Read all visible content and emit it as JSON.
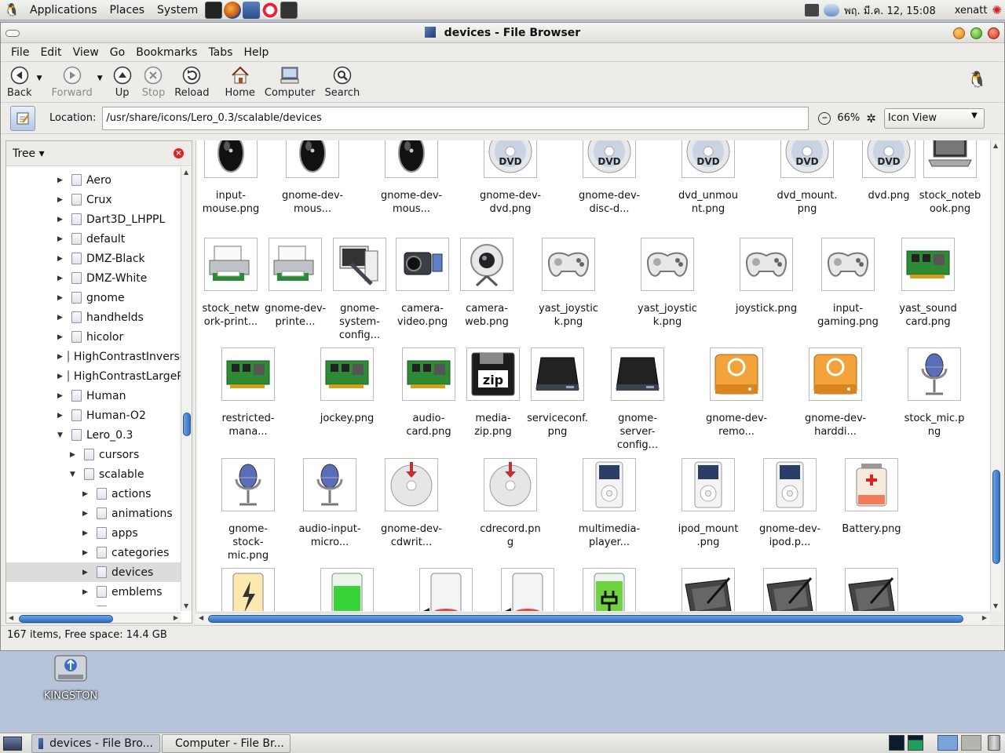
{
  "panel": {
    "menus": [
      "Applications",
      "Places",
      "System"
    ],
    "clock": "พฤ. มี.ค. 12, 15:08",
    "user": "xenatt"
  },
  "window": {
    "title": "devices - File Browser",
    "menus": [
      "File",
      "Edit",
      "View",
      "Go",
      "Bookmarks",
      "Tabs",
      "Help"
    ],
    "toolbar": {
      "back": "Back",
      "forward": "Forward",
      "up": "Up",
      "stop": "Stop",
      "reload": "Reload",
      "home": "Home",
      "computer": "Computer",
      "search": "Search"
    },
    "location_label": "Location:",
    "location": "/usr/share/icons/Lero_0.3/scalable/devices",
    "zoom": "66%",
    "view_mode": "Icon View",
    "sidebar_mode": "Tree",
    "status": "167 items, Free space: 14.4 GB"
  },
  "tree": [
    {
      "label": "Aero",
      "depth": 0,
      "expanded": false
    },
    {
      "label": "Crux",
      "depth": 0,
      "expanded": false
    },
    {
      "label": "Dart3D_LHPPL",
      "depth": 0,
      "expanded": false
    },
    {
      "label": "default",
      "depth": 0,
      "expanded": false
    },
    {
      "label": "DMZ-Black",
      "depth": 0,
      "expanded": false
    },
    {
      "label": "DMZ-White",
      "depth": 0,
      "expanded": false
    },
    {
      "label": "gnome",
      "depth": 0,
      "expanded": false
    },
    {
      "label": "handhelds",
      "depth": 0,
      "expanded": false
    },
    {
      "label": "hicolor",
      "depth": 0,
      "expanded": false
    },
    {
      "label": "HighContrastInverse",
      "depth": 0,
      "expanded": false
    },
    {
      "label": "HighContrastLargePrint",
      "depth": 0,
      "expanded": false
    },
    {
      "label": "Human",
      "depth": 0,
      "expanded": false
    },
    {
      "label": "Human-O2",
      "depth": 0,
      "expanded": false
    },
    {
      "label": "Lero_0.3",
      "depth": 0,
      "expanded": true
    },
    {
      "label": "cursors",
      "depth": 1,
      "expanded": false
    },
    {
      "label": "scalable",
      "depth": 1,
      "expanded": true
    },
    {
      "label": "actions",
      "depth": 2,
      "expanded": false
    },
    {
      "label": "animations",
      "depth": 2,
      "expanded": false
    },
    {
      "label": "apps",
      "depth": 2,
      "expanded": false
    },
    {
      "label": "categories",
      "depth": 2,
      "expanded": false
    },
    {
      "label": "devices",
      "depth": 2,
      "expanded": false,
      "selected": true
    },
    {
      "label": "emblems",
      "depth": 2,
      "expanded": false
    },
    {
      "label": "mimetypes",
      "depth": 2,
      "expanded": false
    }
  ],
  "files": [
    [
      {
        "name": "input-mouse.png",
        "type": "mouse"
      },
      {
        "name": "gnome-dev-mous...",
        "type": "mouse"
      },
      {
        "name": "gnome-dev-mous...",
        "type": "mouse"
      },
      {
        "name": "gnome-dev-dvd.png",
        "type": "dvd"
      },
      {
        "name": "gnome-dev-disc-d...",
        "type": "dvd"
      },
      {
        "name": "dvd_unmount.png",
        "type": "dvd"
      },
      {
        "name": "dvd_mount.png",
        "type": "dvd"
      },
      {
        "name": "dvd.png",
        "type": "dvd"
      },
      {
        "name": "stock_notebook.png",
        "type": "laptop"
      }
    ],
    [
      {
        "name": "stock_network-print...",
        "type": "printer"
      },
      {
        "name": "gnome-dev-printe...",
        "type": "printer"
      },
      {
        "name": "gnome-system-config...",
        "type": "sysconfig"
      },
      {
        "name": "camera-video.png",
        "type": "camcorder"
      },
      {
        "name": "camera-web.png",
        "type": "webcam"
      },
      {
        "name": "yast_joystick.png",
        "type": "joystick"
      },
      {
        "name": "yast_joystick.png",
        "type": "joystick"
      },
      {
        "name": "joystick.png",
        "type": "joystick"
      },
      {
        "name": "input-gaming.png",
        "type": "joystick"
      },
      {
        "name": "yast_soundcard.png",
        "type": "card"
      }
    ],
    [
      {
        "name": "restricted-mana...",
        "type": "card"
      },
      {
        "name": "jockey.png",
        "type": "card"
      },
      {
        "name": "audio-card.png",
        "type": "card"
      },
      {
        "name": "media-zip.png",
        "type": "zip"
      },
      {
        "name": "serviceconf.png",
        "type": "drive"
      },
      {
        "name": "gnome-server-config...",
        "type": "drive"
      },
      {
        "name": "gnome-dev-remo...",
        "type": "orange"
      },
      {
        "name": "gnome-dev-harddi...",
        "type": "orange"
      },
      {
        "name": "stock_mic.png",
        "type": "mic"
      }
    ],
    [
      {
        "name": "gnome-stock-mic.png",
        "type": "mic"
      },
      {
        "name": "audio-input-micro...",
        "type": "mic"
      },
      {
        "name": "gnome-dev-cdwrit...",
        "type": "cdwriter"
      },
      {
        "name": "cdrecord.png",
        "type": "cdwriter"
      },
      {
        "name": "multimedia-player...",
        "type": "ipod"
      },
      {
        "name": "ipod_mount.png",
        "type": "ipod"
      },
      {
        "name": "gnome-dev-ipod.p...",
        "type": "ipod"
      },
      {
        "name": "Battery.png",
        "type": "battery"
      }
    ],
    [
      {
        "name": "",
        "type": "battery-yellow"
      },
      {
        "name": "",
        "type": "battery-green"
      },
      {
        "name": "",
        "type": "battery-red"
      },
      {
        "name": "",
        "type": "battery-red"
      },
      {
        "name": "",
        "type": "battery-plug"
      },
      {
        "name": "",
        "type": "tablet"
      },
      {
        "name": "",
        "type": "tablet"
      },
      {
        "name": "",
        "type": "tablet"
      }
    ]
  ],
  "desktop": {
    "icon_label": "KINGSTON"
  },
  "taskbar": [
    {
      "label": "devices - File Bro...",
      "active": true
    },
    {
      "label": "Computer - File Br...",
      "active": false
    }
  ]
}
